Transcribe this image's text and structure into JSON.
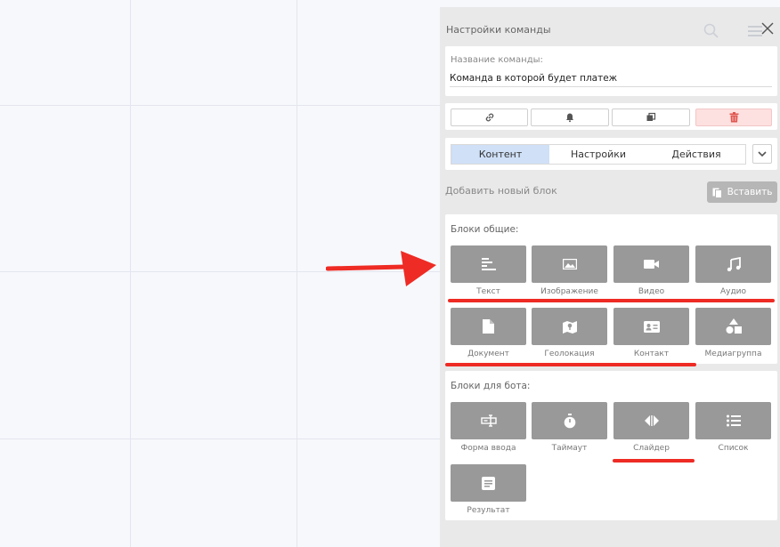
{
  "panel": {
    "title": "Настройки команды",
    "name_field": {
      "label": "Название команды:",
      "value": "Команда в которой будет платеж"
    },
    "actions": [
      {
        "icon": "link-icon"
      },
      {
        "icon": "bell-icon"
      },
      {
        "icon": "copy-icon"
      },
      {
        "icon": "trash-icon",
        "color": "#e0564f"
      }
    ],
    "tabs": [
      {
        "label": "Контент",
        "active": true
      },
      {
        "label": "Настройки",
        "active": false
      },
      {
        "label": "Действия",
        "active": false
      }
    ],
    "add_block_label": "Добавить новый блок",
    "paste_label": "Вставить",
    "general_section": {
      "title": "Блоки общие:",
      "blocks": [
        {
          "label": "Текст",
          "icon": "text-icon"
        },
        {
          "label": "Изображение",
          "icon": "image-icon"
        },
        {
          "label": "Видео",
          "icon": "video-icon"
        },
        {
          "label": "Аудио",
          "icon": "music-icon"
        },
        {
          "label": "Документ",
          "icon": "document-icon"
        },
        {
          "label": "Геолокация",
          "icon": "map-icon"
        },
        {
          "label": "Контакт",
          "icon": "contact-card-icon"
        },
        {
          "label": "Медиагруппа",
          "icon": "shapes-icon"
        }
      ]
    },
    "bot_section": {
      "title": "Блоки для бота:",
      "blocks": [
        {
          "label": "Форма ввода",
          "icon": "input-form-icon"
        },
        {
          "label": "Таймаут",
          "icon": "stopwatch-icon"
        },
        {
          "label": "Слайдер",
          "icon": "slider-icon"
        },
        {
          "label": "Список",
          "icon": "list-icon"
        },
        {
          "label": "Результат",
          "icon": "result-icon"
        }
      ]
    }
  },
  "colors": {
    "accent_tab": "#cfe0f7",
    "block": "#999999",
    "annotation": "#ee2b24"
  }
}
